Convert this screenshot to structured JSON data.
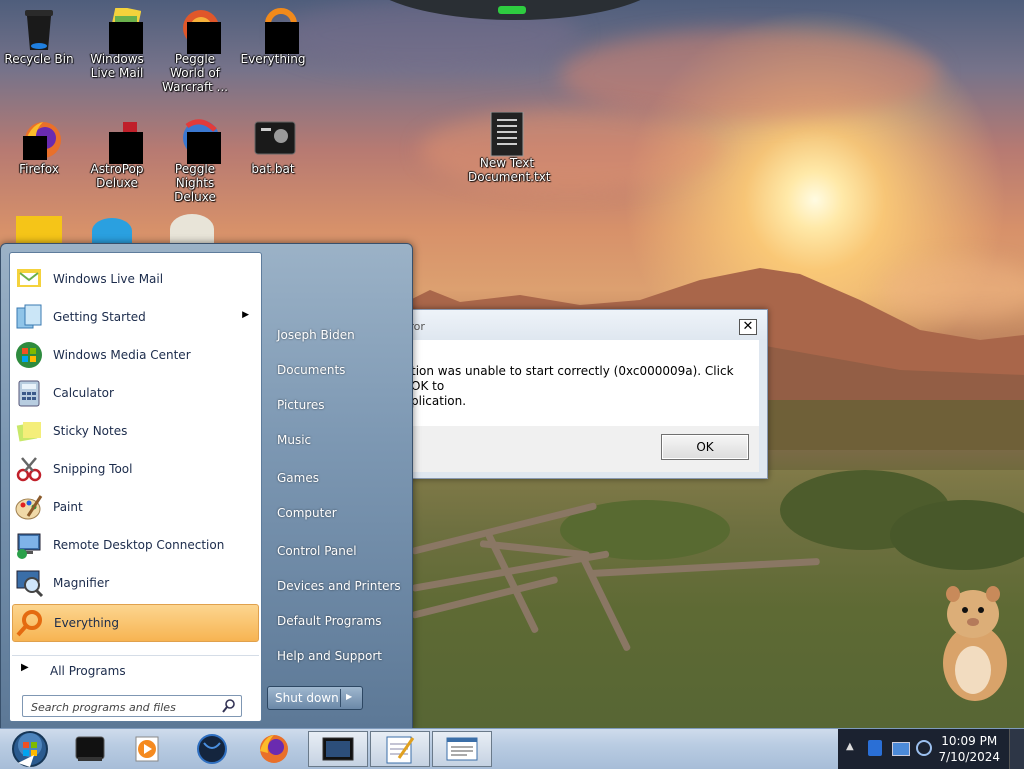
{
  "desktop": {
    "icons": [
      {
        "label": "Recycle Bin",
        "icon": "recycle-bin-icon"
      },
      {
        "label": "Windows Live Mail",
        "icon": "windows-live-mail-icon"
      },
      {
        "label": "Peggle World of Warcraft ...",
        "icon": "peggle-wow-icon"
      },
      {
        "label": "Everything",
        "icon": "everything-icon"
      },
      {
        "label": "Firefox",
        "icon": "firefox-icon"
      },
      {
        "label": "AstroPop Deluxe",
        "icon": "astropop-icon"
      },
      {
        "label": "Peggle Nights Deluxe",
        "icon": "peggle-nights-icon"
      },
      {
        "label": "bat.bat",
        "icon": "batch-file-icon"
      },
      {
        "label": "New Text Document.txt",
        "icon": "text-document-icon"
      }
    ]
  },
  "dialog": {
    "title": "rror",
    "message_line1": "tion was unable to start correctly (0xc000009a). Click OK to",
    "message_line2": "plication.",
    "ok_label": "OK",
    "close_label": "✕"
  },
  "start_menu": {
    "programs": [
      {
        "label": "Windows Live Mail",
        "icon": "windows-live-mail-icon"
      },
      {
        "label": "Getting Started",
        "icon": "getting-started-icon",
        "has_submenu": true
      },
      {
        "label": "Windows Media Center",
        "icon": "media-center-icon"
      },
      {
        "label": "Calculator",
        "icon": "calculator-icon"
      },
      {
        "label": "Sticky Notes",
        "icon": "sticky-notes-icon"
      },
      {
        "label": "Snipping Tool",
        "icon": "snipping-tool-icon"
      },
      {
        "label": "Paint",
        "icon": "paint-icon"
      },
      {
        "label": "Remote Desktop Connection",
        "icon": "remote-desktop-icon"
      },
      {
        "label": "Magnifier",
        "icon": "magnifier-icon"
      },
      {
        "label": "Everything",
        "icon": "everything-icon",
        "selected": true
      }
    ],
    "all_programs_label": "All Programs",
    "search_placeholder": "Search programs and files",
    "right_links": [
      "Joseph Biden",
      "Documents",
      "Pictures",
      "Music",
      "Games",
      "Computer",
      "Control Panel",
      "Devices and Printers",
      "Default Programs",
      "Help and Support"
    ],
    "shutdown_label": "Shut down"
  },
  "taskbar": {
    "pinned": [
      "start-orb-icon",
      "terminal-icon",
      "media-player-icon",
      "globe-icon",
      "firefox-icon",
      "window-icon",
      "notepad-icon",
      "window-text-icon"
    ],
    "clock_time": "10:09 PM",
    "clock_date": "7/10/2024"
  }
}
